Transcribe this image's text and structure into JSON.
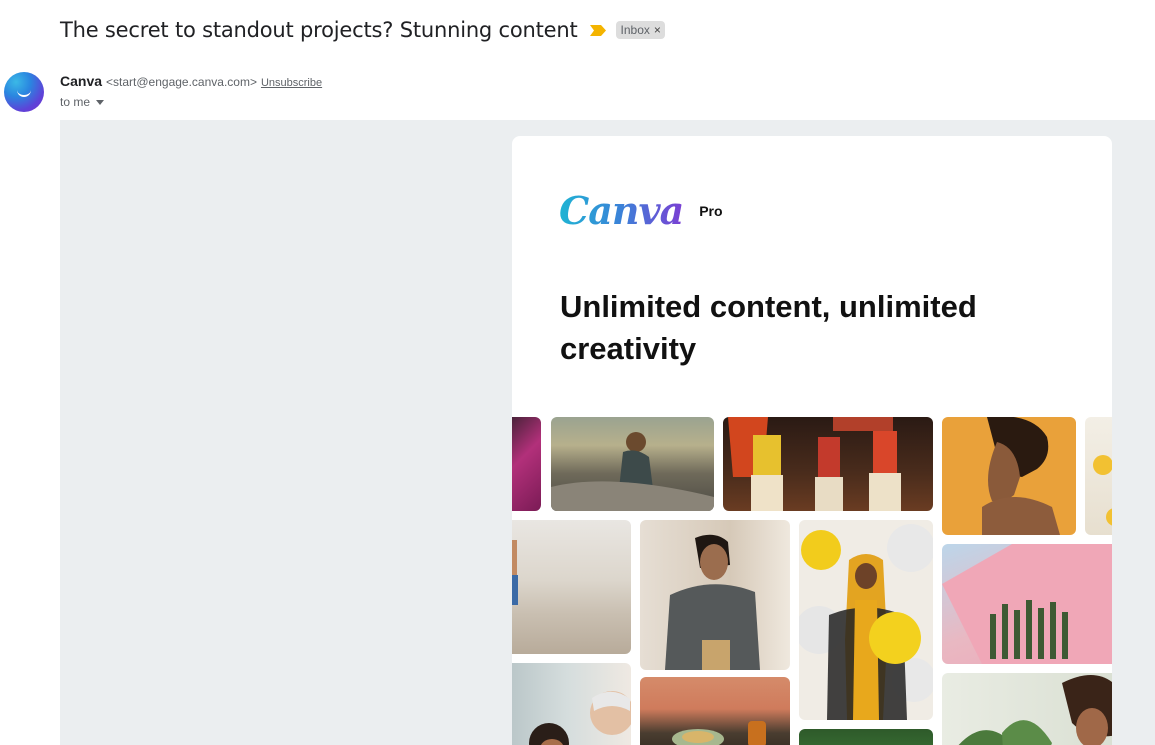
{
  "email": {
    "subject": "The secret to standout projects? Stunning content",
    "label": "Inbox",
    "label_close": "×",
    "sender_name": "Canva",
    "sender_email": "<start@engage.canva.com>",
    "unsubscribe": "Unsubscribe",
    "recipient": "to me"
  },
  "body": {
    "logo": "Canva",
    "logo_badge": "Pro",
    "headline": "Unlimited content, unlimited creativity"
  },
  "colors": {
    "importance_marker": "#f4b400",
    "label_chip": "#dddddd",
    "email_background": "#ebeef0",
    "brand_gradient": [
      "#1fb4d4",
      "#7b3fd4"
    ]
  },
  "icons": {
    "importance": "importance-marker-icon",
    "avatar": "canva-avatar-icon",
    "dropdown": "caret-down-icon"
  },
  "collage_images": [
    "magenta-fabric",
    "hiker-on-rock",
    "traditional-dancers",
    "woman-orange-background",
    "flowers-edge",
    "beach-walker",
    "woman-grey-sweater",
    "woman-yellow-hijab-fans",
    "pink-wall-cactus",
    "grandfather-child",
    "table-with-food",
    "green-trees",
    "woman-with-plants"
  ]
}
